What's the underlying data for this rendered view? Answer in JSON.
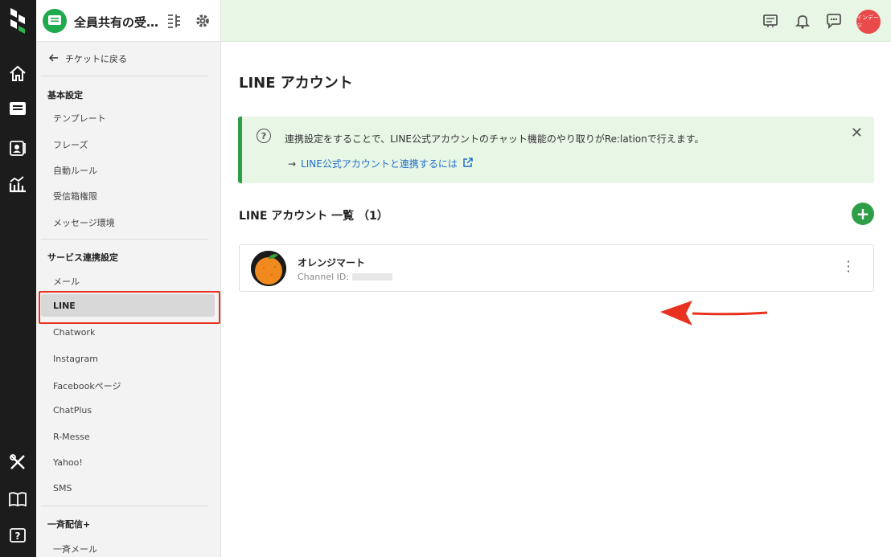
{
  "header": {
    "inbox_title": "全員共有の受…",
    "avatar_label": "インデージ"
  },
  "sidebar": {
    "back_label": "チケットに戻る",
    "section_basic": "基本設定",
    "basic_items": [
      "テンプレート",
      "フレーズ",
      "自動ルール",
      "受信箱権限",
      "メッセージ環境"
    ],
    "section_service": "サービス連携設定",
    "service_items": [
      "メール",
      "LINE",
      "Chatwork",
      "Instagram",
      "Facebookページ",
      "ChatPlus",
      "R-Messe",
      "Yahoo!",
      "SMS"
    ],
    "active_item": "LINE",
    "section_broadcast": "一斉配信+",
    "broadcast_items": [
      "一斉メール"
    ]
  },
  "main": {
    "title": "LINE アカウント",
    "notice_message": "連携設定をすることで、LINE公式アカウントのチャット機能のやり取りがRe:lationで行えます。",
    "notice_link": "LINE公式アカウントと連携するには",
    "list_title": "LINE アカウント 一覧 （1）",
    "accounts": [
      {
        "name": "オレンジマート",
        "channel_label": "Channel ID:"
      }
    ]
  },
  "colors": {
    "brand_green": "#2f9e48",
    "header_bg": "#e8f6e6",
    "highlight_red": "#e8321f",
    "link_blue": "#1e6fc9"
  }
}
